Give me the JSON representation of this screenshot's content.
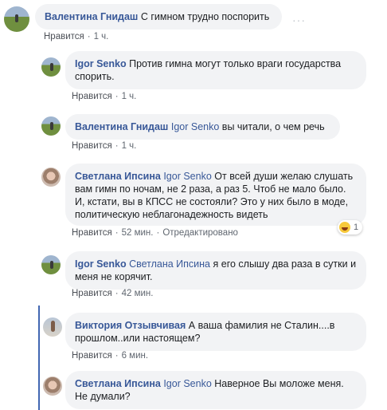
{
  "comments": [
    {
      "author": "Валентина Гнидаш",
      "mention": "",
      "text": "С гимном трудно поспорить",
      "meta": {
        "like": "Нравится",
        "time": "1 ч.",
        "edited": ""
      }
    },
    {
      "author": "Igor Senko",
      "mention": "",
      "text": "Против гимна могут только враги государства спорить.",
      "meta": {
        "like": "Нравится",
        "time": "1 ч.",
        "edited": ""
      }
    },
    {
      "author": "Валентина Гнидаш",
      "mention": "Igor Senko",
      "text": "вы читали, о чем речь",
      "meta": {
        "like": "Нравится",
        "time": "1 ч.",
        "edited": ""
      }
    },
    {
      "author": "Светлана Ипсина",
      "mention": "Igor Senko",
      "text": "От всей души желаю слушать вам гимн по ночам, не 2 раза, а раз 5. Чтоб не мало было. И, кстати, вы в КПСС не состояли? Это у них было в моде, политическую неблагонадежность видеть",
      "meta": {
        "like": "Нравится",
        "time": "52 мин.",
        "edited": "Отредактировано"
      },
      "reaction": {
        "icon": "haha-reaction-icon",
        "count": "1"
      }
    },
    {
      "author": "Igor Senko",
      "mention": "Светлана Ипсина",
      "text": "я его слышу два раза в сутки и меня не корячит.",
      "meta": {
        "like": "Нравится",
        "time": "42 мин.",
        "edited": ""
      }
    },
    {
      "author": "Виктория Отзывчивая",
      "mention": "",
      "text": "А ваша фамилия не Сталин....в прошлом..или настоящем?",
      "meta": {
        "like": "Нравится",
        "time": "6 мин.",
        "edited": ""
      }
    },
    {
      "author": "Светлана Ипсина",
      "mention": "Igor Senko",
      "text": "Наверное Вы моложе меня. Не думали?",
      "meta": {
        "like": "",
        "time": "",
        "edited": ""
      }
    }
  ],
  "options_icon": "more-options-icon",
  "colors": {
    "author": "#385898",
    "bubble": "#f2f3f5",
    "meta": "#606770",
    "thread_line": "#4267b2"
  }
}
